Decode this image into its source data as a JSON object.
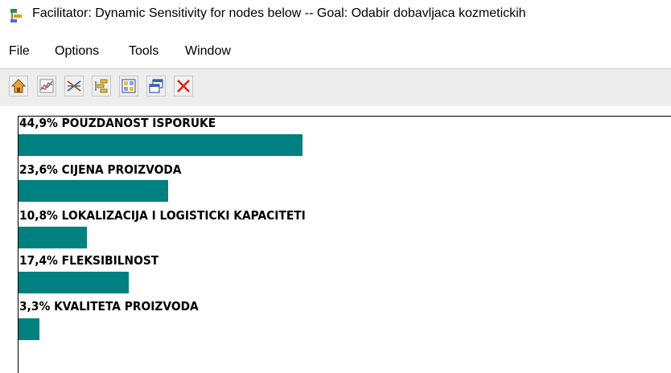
{
  "window": {
    "title": "Facilitator: Dynamic Sensitivity for nodes below -- Goal: Odabir dobavljaca kozmetickih"
  },
  "menu": [
    {
      "label": "File"
    },
    {
      "label": "Options"
    },
    {
      "label": "Tools"
    },
    {
      "label": "Window"
    }
  ],
  "toolbar": {
    "buttons": [
      {
        "icon": "home-icon"
      },
      {
        "icon": "chart-icon"
      },
      {
        "icon": "star-icon"
      },
      {
        "icon": "tree-icon"
      },
      {
        "icon": "grid-icon"
      },
      {
        "icon": "window-icon"
      },
      {
        "icon": "close-icon",
        "color": "#e0201b"
      }
    ]
  },
  "sensitivity": {
    "bar_color": "#008080",
    "items": [
      {
        "label": "44,9% POUZDANOST ISPORUKE",
        "value": 44.9
      },
      {
        "label": "23,6% CIJENA PROIZVODA",
        "value": 23.6
      },
      {
        "label": "10,8% LOKALIZACIJA I LOGISTICKI KAPACITETI",
        "value": 10.8
      },
      {
        "label": "17,4% FLEKSIBILNOST",
        "value": 17.4
      },
      {
        "label": "3,3% KVALITETA PROIZVODA",
        "value": 3.3
      }
    ]
  }
}
